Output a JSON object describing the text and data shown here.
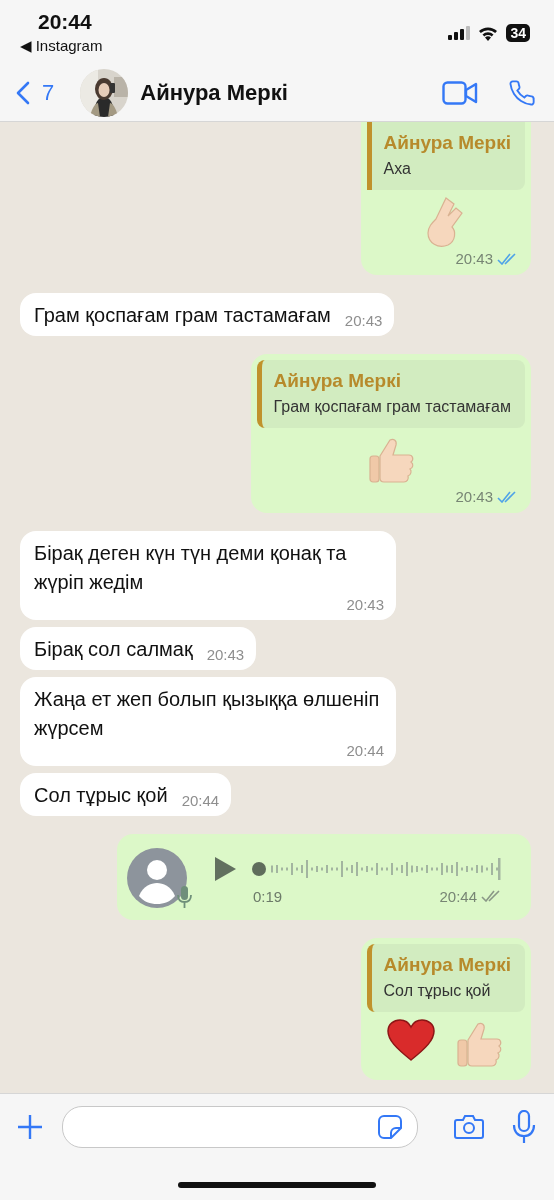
{
  "status_bar": {
    "time": "20:44",
    "back_app": "◀ Instagram",
    "battery": "34"
  },
  "header": {
    "back_count": "7",
    "contact_name": "Айнура Меркі"
  },
  "messages": [
    {
      "kind": "reply",
      "quote_name": "Айнура Меркі",
      "quote_text": "Аха",
      "sticker": {
        "kind": "finger-heart"
      },
      "time": "20:43",
      "read": true
    },
    {
      "kind": "incoming",
      "text": "Грам қоспағам грам тастамағам",
      "time": "20:43"
    },
    {
      "kind": "reply",
      "quote_name": "Айнура Меркі",
      "quote_text": "Грам қоспағам грам тастамағам",
      "sticker": {
        "kind": "thumbs-up"
      },
      "time": "20:43",
      "read": true
    },
    {
      "kind": "incoming",
      "text": "Бірақ деген күн түн деми қонақ та жүріп жедім",
      "time": "20:43"
    },
    {
      "kind": "incoming",
      "text": "Бірақ сол салмақ",
      "time": "20:43"
    },
    {
      "kind": "incoming",
      "text": "Жаңа ет жеп болып қызыққа өлшеніп жүрсем",
      "time": "20:44"
    },
    {
      "kind": "incoming",
      "text": "Сол тұрыс қой",
      "time": "20:44"
    },
    {
      "kind": "voice",
      "duration": "0:19",
      "time": "20:44",
      "read": false
    },
    {
      "kind": "reply",
      "quote_name": "Айнура Меркі",
      "quote_text": "Сол тұрыс қой",
      "sticker": {
        "kind": "heart-thumbs"
      }
    }
  ]
}
